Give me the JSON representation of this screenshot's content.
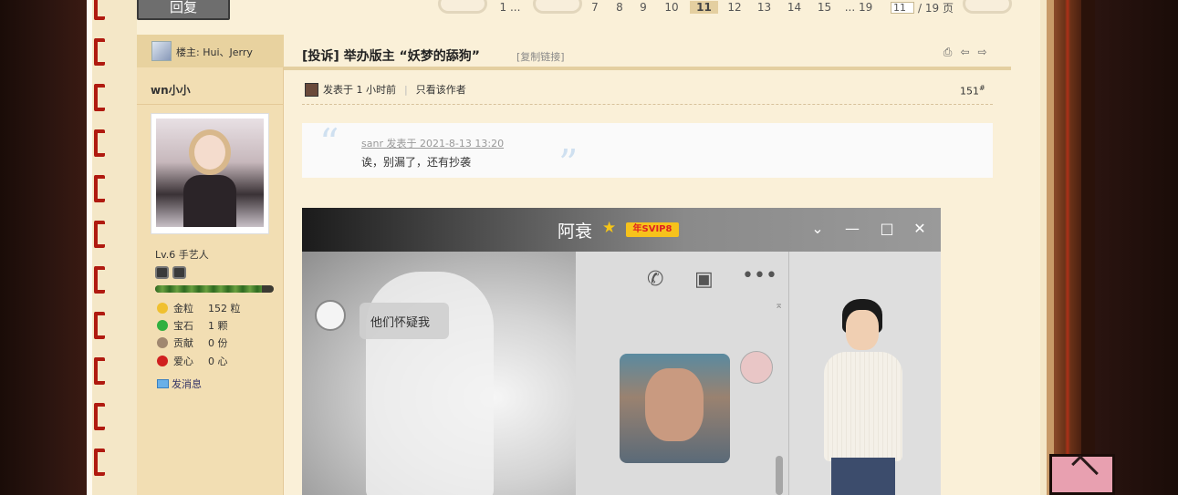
{
  "page": {
    "reply_button": "回复"
  },
  "pager": {
    "pages": [
      "1 ...",
      "7",
      "8",
      "9",
      "10",
      "11",
      "12",
      "13",
      "14",
      "15",
      "... 19"
    ],
    "current": "11",
    "input_value": "11",
    "total_label": "/ 19 页"
  },
  "sidebar": {
    "author_label": "楼主: Hui、Jerry",
    "username": "wn小小",
    "level": "Lv.6 手艺人",
    "exp_fraction": 0.9,
    "stats": [
      {
        "label": "金粒",
        "value": "152 粒",
        "icon": "gold-icon",
        "color": "#f0c030"
      },
      {
        "label": "宝石",
        "value": "1 颗",
        "icon": "gem-icon",
        "color": "#30b040"
      },
      {
        "label": "贡献",
        "value": "0 份",
        "icon": "contribution-icon",
        "color": "#a08870"
      },
      {
        "label": "爱心",
        "value": "0 心",
        "icon": "heart-icon",
        "color": "#d02020"
      }
    ],
    "message_link": "发消息"
  },
  "post": {
    "title": "[投诉] 举办版主 “妖梦的舔狗”",
    "copy_link": "[复制链接]",
    "posted_time": "发表于 1 小时前",
    "only_author": "只看该作者",
    "floor": "151",
    "floor_suffix": "#"
  },
  "quote": {
    "header": "sanr    发表于 2021-8-13 13:20",
    "text": "诶，别漏了，还有抄袭"
  },
  "screenshot": {
    "contact_name": "阿衰",
    "vip_badge": "年SVIP8",
    "chat_message": "他们怀疑我"
  }
}
